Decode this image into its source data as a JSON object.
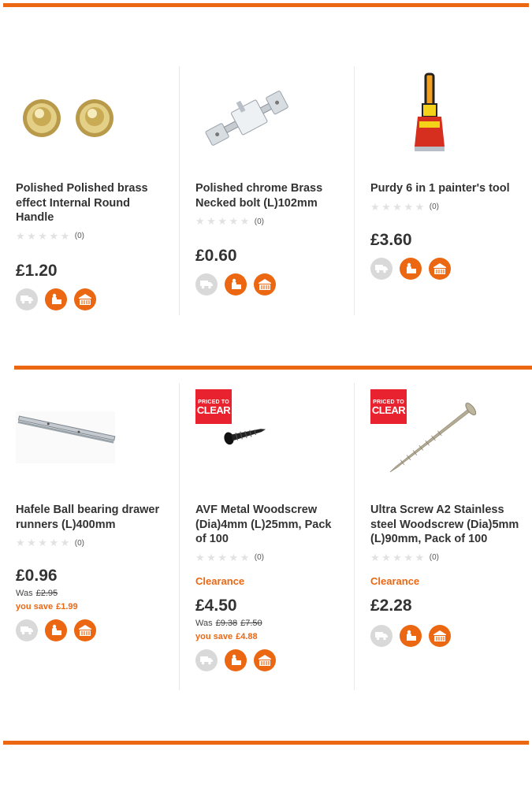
{
  "accent_color": "#ec6712",
  "rows": [
    [
      {
        "title": "Polished Polished brass effect Internal Round Handle",
        "stars": "★★★★★",
        "review_count": "(0)",
        "price": "£1.20",
        "image": "brass-knobs"
      },
      {
        "title": "Polished chrome Brass Necked bolt (L)102mm",
        "stars": "★★★★★",
        "review_count": "(0)",
        "price": "£0.60",
        "image": "chrome-bolt"
      },
      {
        "title": "Purdy 6 in 1 painter's tool",
        "stars": "★★★★★",
        "review_count": "(0)",
        "price": "£3.60",
        "image": "painters-tool"
      }
    ],
    [
      {
        "title": "Hafele Ball bearing drawer runners (L)400mm",
        "stars": "★★★★★",
        "review_count": "(0)",
        "price": "£0.96",
        "was_label": "Was",
        "was_price": "£2.95",
        "save_label": "you save",
        "save_amount": "£1.99",
        "image": "drawer-runner"
      },
      {
        "badge_line1": "PRICED TO",
        "badge_line2": "CLEAR",
        "title": "AVF Metal Woodscrew (Dia)4mm (L)25mm, Pack of 100",
        "stars": "★★★★★",
        "review_count": "(0)",
        "clearance": "Clearance",
        "price": "£4.50",
        "was_label": "Was",
        "was_price": "£9.38",
        "was_price2": "£7.50",
        "save_label": "you save",
        "save_amount": "£4.88",
        "image": "black-screw"
      },
      {
        "badge_line1": "PRICED TO",
        "badge_line2": "CLEAR",
        "title": "Ultra Screw A2 Stainless steel Woodscrew (Dia)5mm (L)90mm, Pack of 100",
        "stars": "★★★★★",
        "review_count": "(0)",
        "clearance": "Clearance",
        "price": "£2.28",
        "image": "long-screw"
      }
    ]
  ],
  "icons": [
    "delivery-icon",
    "click-collect-icon",
    "store-icon"
  ]
}
